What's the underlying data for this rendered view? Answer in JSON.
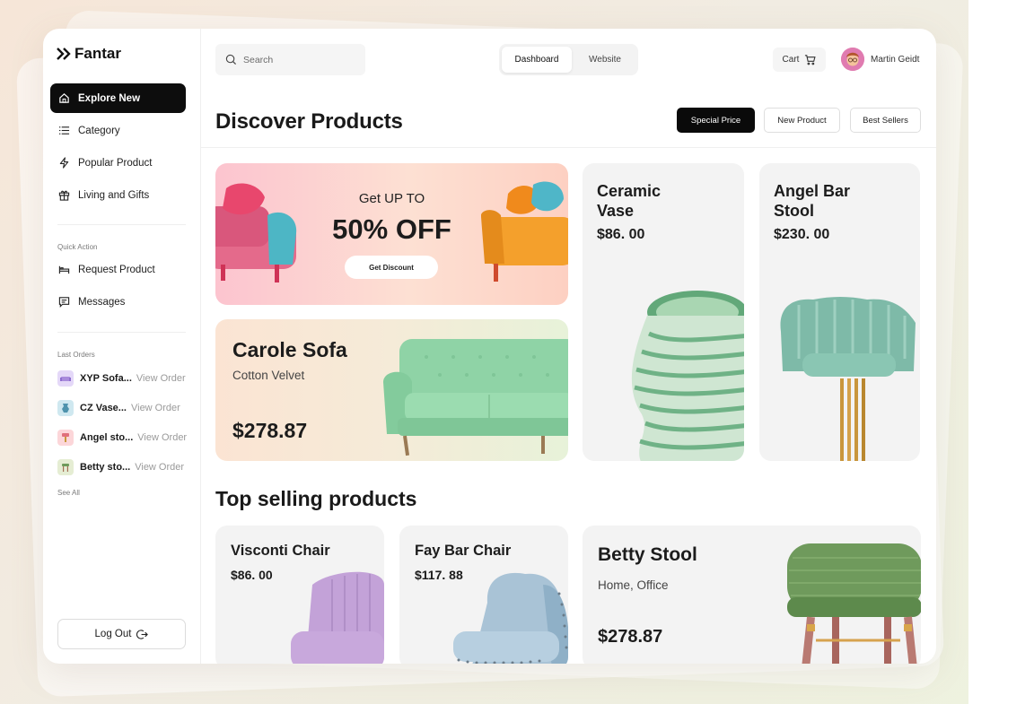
{
  "brand": {
    "name": "Fantar"
  },
  "sidebar": {
    "nav": [
      {
        "label": "Explore New",
        "icon": "home-icon",
        "active": true
      },
      {
        "label": "Category",
        "icon": "list-icon",
        "active": false
      },
      {
        "label": "Popular Product",
        "icon": "lightning-icon",
        "active": false
      },
      {
        "label": "Living and Gifts",
        "icon": "gift-icon",
        "active": false
      }
    ],
    "quick_action_label": "Quick Action",
    "quick_actions": [
      {
        "label": "Request Product",
        "icon": "bed-icon"
      },
      {
        "label": "Messages",
        "icon": "message-icon"
      }
    ],
    "last_orders_label": "Last Orders",
    "orders": [
      {
        "name": "XYP Sofa...",
        "link": "View Order",
        "color": "#d9c8f5"
      },
      {
        "name": "CZ  Vase...",
        "link": "View Order",
        "color": "#c9e6ef"
      },
      {
        "name": "Angel sto...",
        "link": "View Order",
        "color": "#fbd2d6"
      },
      {
        "name": "Betty sto...",
        "link": "View Order",
        "color": "#e2ebcf"
      }
    ],
    "see_all": "See All",
    "logout": "Log Out"
  },
  "header": {
    "search_placeholder": "Search",
    "tabs": [
      "Dashboard",
      "Website"
    ],
    "cart_label": "Cart",
    "user_name": "Martin Geidt"
  },
  "main": {
    "title": "Discover Products",
    "filters": [
      "Special Price",
      "New Product",
      "Best Sellers"
    ],
    "promo": {
      "subtitle": "Get UP TO",
      "headline": "50% OFF",
      "button": "Get Discount"
    },
    "featured": {
      "name": "Carole Sofa",
      "material": "Cotton Velvet",
      "price": "$278.87"
    },
    "products": [
      {
        "name": "Ceramic Vase",
        "price": "$86. 00"
      },
      {
        "name": "Angel Bar Stool",
        "price": "$230. 00"
      }
    ],
    "top_selling_title": "Top selling products",
    "top_selling": [
      {
        "name": "Visconti Chair",
        "price": "$86. 00"
      },
      {
        "name": "Fay Bar Chair",
        "price": "$117. 88"
      }
    ],
    "betty": {
      "name": "Betty Stool",
      "category": "Home, Office",
      "price": "$278.87"
    }
  },
  "colors": {
    "accent": "#0d0d0d",
    "promo_pink": "#fcc4cf",
    "mint": "#8fd3a6"
  }
}
